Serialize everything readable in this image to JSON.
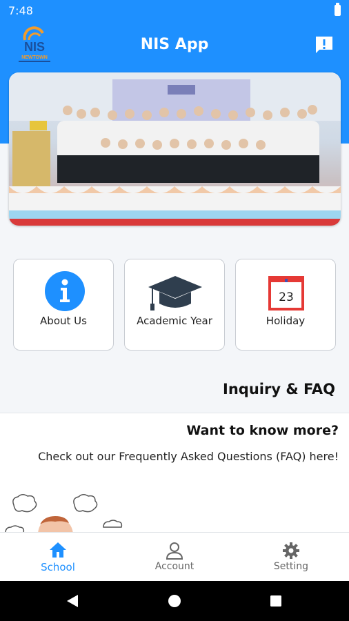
{
  "status_bar": {
    "time": "7:48"
  },
  "header": {
    "logo_text": "NIS",
    "logo_subtext": "NEWTOWN",
    "title": "NIS App"
  },
  "menu_cards": [
    {
      "label": "About Us",
      "icon": "info-icon"
    },
    {
      "label": "Academic Year",
      "icon": "graduation-cap-icon"
    },
    {
      "label": "Holiday",
      "icon": "calendar-icon",
      "day": "23"
    }
  ],
  "faq": {
    "heading": "Inquiry & FAQ",
    "title": "Want to know more?",
    "description": "Check out our Frequently Asked Questions (FAQ) here!"
  },
  "bottom_nav": [
    {
      "label": "School",
      "icon": "home-icon",
      "active": true
    },
    {
      "label": "Account",
      "icon": "user-icon",
      "active": false
    },
    {
      "label": "Setting",
      "icon": "gear-icon",
      "active": false
    }
  ],
  "colors": {
    "primary": "#1e90ff",
    "calendar_red": "#e53935",
    "cap": "#2f3e4e"
  }
}
